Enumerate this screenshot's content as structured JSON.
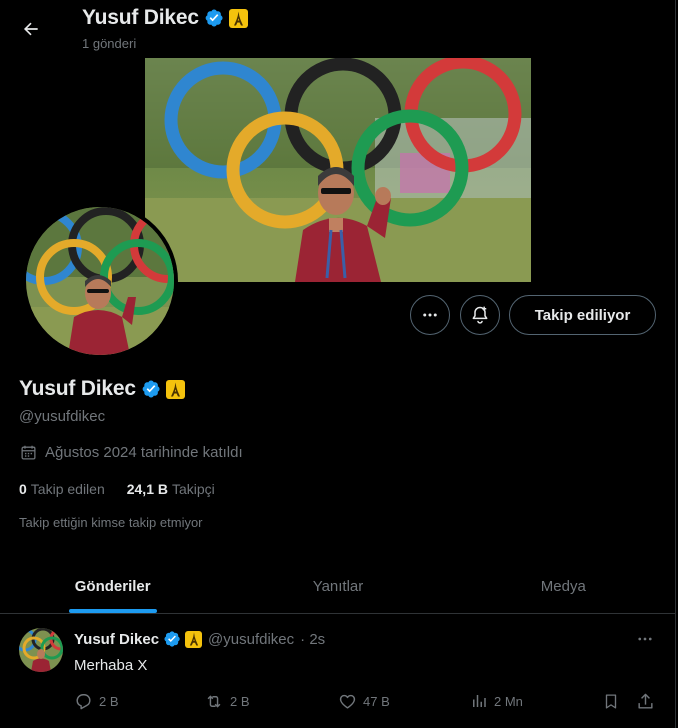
{
  "header": {
    "name": "Yusuf Dikec",
    "post_count": "1 gönderi"
  },
  "profile": {
    "name": "Yusuf Dikec",
    "handle": "@yusufdikec",
    "joined": "Ağustos 2024 tarihinde katıldı",
    "following_count": "0",
    "following_label": "Takip edilen",
    "followers_count": "24,1 B",
    "followers_label": "Takipçi",
    "followed_by_note": "Takip ettiğin kimse takip etmiyor"
  },
  "actions": {
    "follow_button": "Takip ediliyor"
  },
  "tabs": [
    {
      "label": "Gönderiler",
      "active": true
    },
    {
      "label": "Yanıtlar",
      "active": false
    },
    {
      "label": "Medya",
      "active": false
    }
  ],
  "tweet": {
    "name": "Yusuf Dikec",
    "handle": "@yusufdikec",
    "time": "· 2s",
    "text": "Merhaba X",
    "replies": "2 B",
    "reposts": "2 B",
    "likes": "47 B",
    "views": "2 Mn"
  },
  "colors": {
    "accent": "#1d9bf0",
    "verified": "#1d9bf0",
    "badge": "#f4c20d",
    "muted": "#71767b",
    "background": "#000000"
  },
  "icons": [
    "back-arrow-icon",
    "verified-icon",
    "eiffel-tower-icon",
    "more-icon",
    "notification-bell-icon",
    "calendar-icon",
    "reply-icon",
    "repost-icon",
    "like-icon",
    "views-icon",
    "bookmark-icon",
    "share-icon"
  ]
}
